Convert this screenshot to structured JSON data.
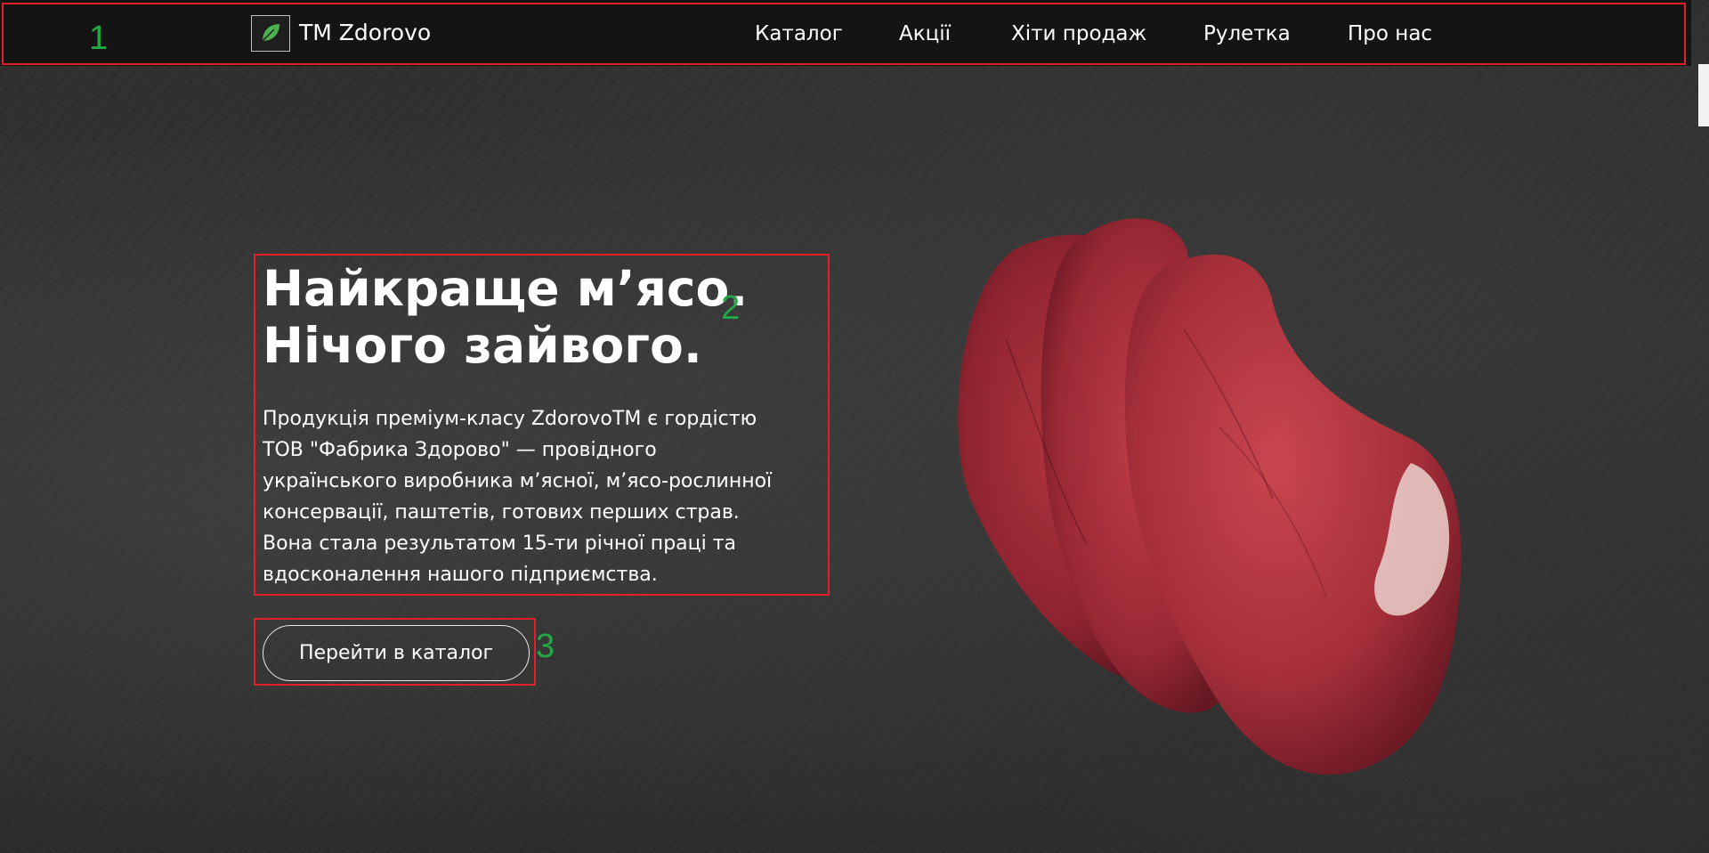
{
  "brand": {
    "name": "ТМ Zdorovo"
  },
  "nav": {
    "items": [
      {
        "label": "Каталог"
      },
      {
        "label": "Акції"
      },
      {
        "label": "Хіти продаж"
      },
      {
        "label": "Рулетка"
      },
      {
        "label": "Про нас"
      }
    ]
  },
  "hero": {
    "headline_line1": "Найкраще м’ясо.",
    "headline_line2": "Нічого зайвого.",
    "intro_lines": [
      "Продукція преміум-класу ZdorovoTM є гордістю",
      "ТОВ \"Фабрика Здорово\" — провідного",
      "українського виробника м’ясної, м’ясо-рослинної",
      "консервації, паштетів, готових перших страв.",
      "Вона стала результатом 15-ти річної праці та",
      "вдосконалення нашого підприємства."
    ],
    "cta_label": "Перейти в каталог"
  },
  "annotations": [
    {
      "number": "1"
    },
    {
      "number": "2"
    },
    {
      "number": "3"
    }
  ],
  "colors": {
    "nav_background": "#141414",
    "annotation_box": "#e0202a",
    "annotation_number": "#22a845",
    "logo_leaf": "#4caf50"
  }
}
